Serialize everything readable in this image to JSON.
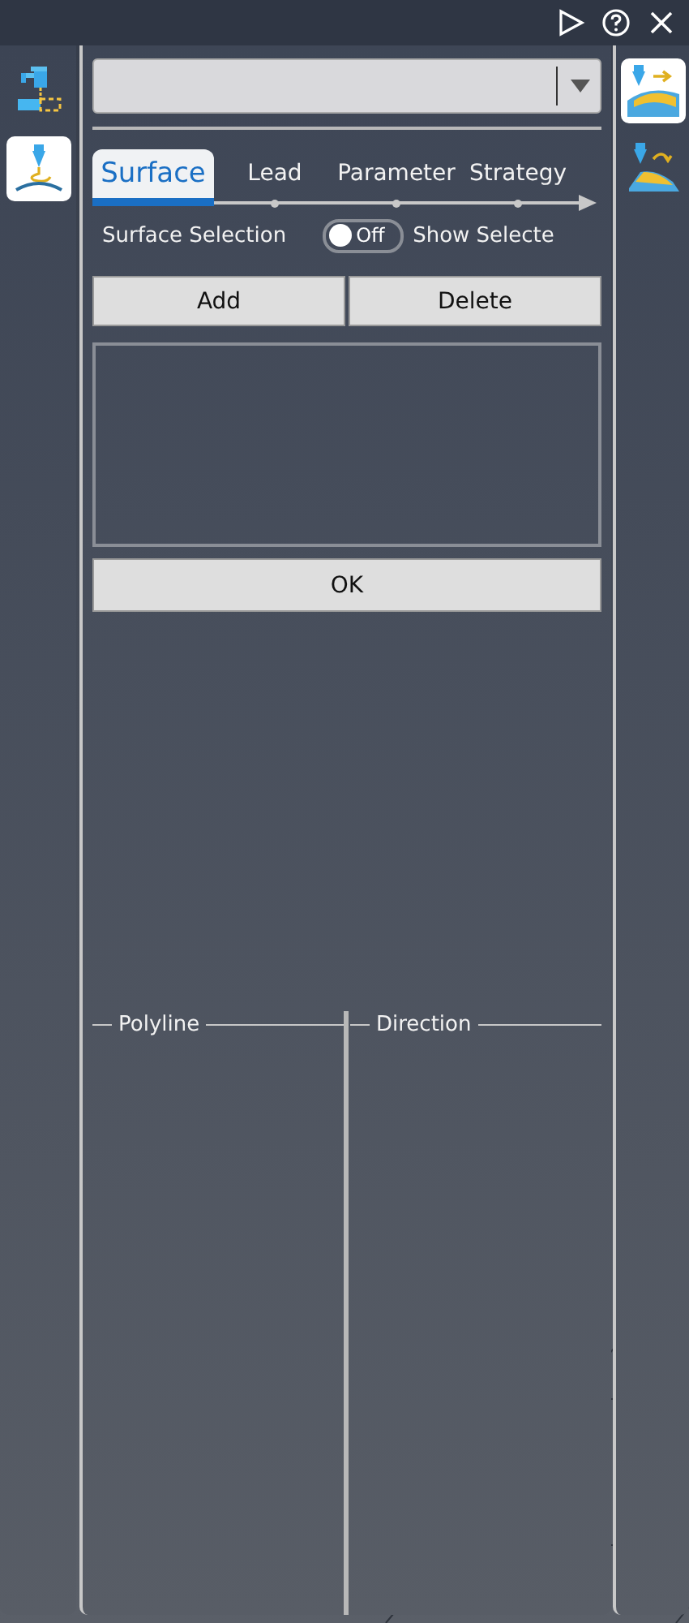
{
  "window": {
    "controls": [
      {
        "kind": "play"
      },
      {
        "kind": "help"
      },
      {
        "kind": "close"
      }
    ]
  },
  "left_toolbar": [
    {
      "kind": "probe",
      "selected": false
    },
    {
      "kind": "path",
      "selected": true
    }
  ],
  "right_toolbar": [
    {
      "kind": "move",
      "selected": true
    },
    {
      "kind": "rotate",
      "selected": false
    }
  ],
  "steps": [
    {
      "label": "Surface",
      "selected": true
    },
    {
      "label": "Lead",
      "selected": false
    },
    {
      "label": "Parameter",
      "selected": false
    },
    {
      "label": "Strategy",
      "selected": false
    }
  ],
  "surface_selection": {
    "label": "Surface Selection",
    "toggle": {
      "on": false,
      "text": "Off"
    },
    "toggle_label": "Show Selecte"
  },
  "buttons": [
    "Add",
    "Delete"
  ],
  "ok_button": "OK",
  "groups": [
    {
      "title": "Polyline"
    },
    {
      "title": "Direction"
    }
  ]
}
